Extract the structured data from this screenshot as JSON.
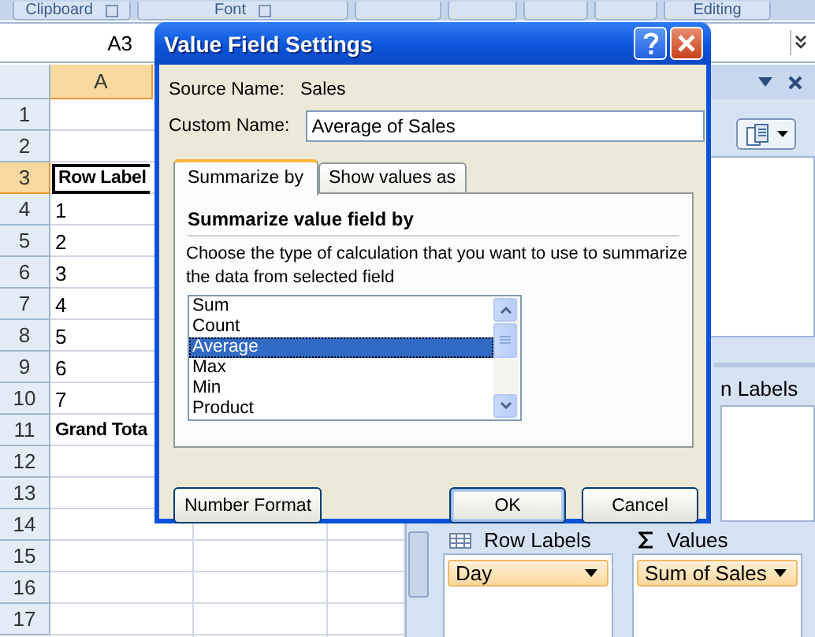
{
  "ribbon": {
    "groups": [
      {
        "label": "Clipboard",
        "launcher": true
      },
      {
        "label": "Font",
        "launcher": true
      },
      {
        "label": "Editing",
        "launcher": false
      }
    ]
  },
  "formula_bar": {
    "name_box": "A3"
  },
  "sheet": {
    "columns": [
      {
        "label": "A",
        "selected": true
      }
    ],
    "rows": [
      {
        "number": "1",
        "selected": false
      },
      {
        "number": "2",
        "selected": false
      },
      {
        "number": "3",
        "selected": true,
        "cell": "Row Label",
        "kind": "heading"
      },
      {
        "number": "4",
        "selected": false,
        "cell": "1",
        "kind": "value"
      },
      {
        "number": "5",
        "selected": false,
        "cell": "2",
        "kind": "value"
      },
      {
        "number": "6",
        "selected": false,
        "cell": "3",
        "kind": "value"
      },
      {
        "number": "7",
        "selected": false,
        "cell": "4",
        "kind": "value"
      },
      {
        "number": "8",
        "selected": false,
        "cell": "5",
        "kind": "value"
      },
      {
        "number": "9",
        "selected": false,
        "cell": "6",
        "kind": "value"
      },
      {
        "number": "10",
        "selected": false,
        "cell": "7",
        "kind": "value"
      },
      {
        "number": "11",
        "selected": false,
        "cell": "Grand Tota",
        "kind": "heading"
      },
      {
        "number": "12",
        "selected": false
      },
      {
        "number": "13",
        "selected": false
      },
      {
        "number": "14",
        "selected": false
      },
      {
        "number": "15",
        "selected": false
      },
      {
        "number": "16",
        "selected": false
      },
      {
        "number": "17",
        "selected": false
      }
    ]
  },
  "pivot_panel": {
    "column_labels_title": "n Labels",
    "row_labels": {
      "title": "Row Labels",
      "fields": [
        "Day"
      ]
    },
    "values": {
      "title": "Values",
      "fields": [
        "Sum of Sales"
      ]
    }
  },
  "dialog": {
    "title": "Value Field Settings",
    "source_name_label": "Source Name:",
    "source_name": "Sales",
    "custom_name_label": "Custom Name:",
    "custom_name": "Average of Sales",
    "tabs": [
      {
        "label": "Summarize by",
        "selected": true
      },
      {
        "label": "Show values as",
        "selected": false
      }
    ],
    "section_title": "Summarize value field by",
    "description": "Choose the type of calculation that you want to use to summarize the data from selected field",
    "functions": [
      {
        "label": "Sum",
        "selected": false
      },
      {
        "label": "Count",
        "selected": false
      },
      {
        "label": "Average",
        "selected": true
      },
      {
        "label": "Max",
        "selected": false
      },
      {
        "label": "Min",
        "selected": false
      },
      {
        "label": "Product",
        "selected": false
      }
    ],
    "buttons": [
      {
        "label": "Number Format",
        "kind": "left"
      },
      {
        "label": "OK",
        "kind": "default"
      },
      {
        "label": "Cancel",
        "kind": "normal"
      }
    ]
  }
}
